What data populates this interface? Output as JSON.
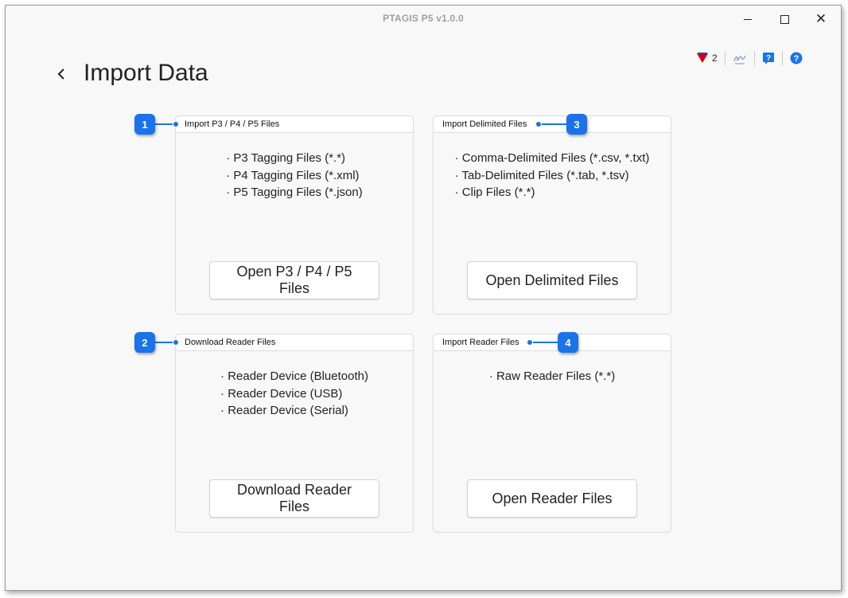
{
  "window": {
    "title": "PTAGIS P5 v1.0.0"
  },
  "toolbar": {
    "filter_count": "2",
    "icons": [
      "filter-flag-icon",
      "sign-icon",
      "help-book-icon",
      "help-circle-icon"
    ],
    "accent_color": "#1a73e8",
    "flag_color": "#d0021b"
  },
  "page": {
    "title": "Import Data"
  },
  "cards": [
    {
      "label": "Import P3 / P4 / P5 Files",
      "items": [
        "· P3 Tagging Files (*.*)",
        "· P4 Tagging Files (*.xml)",
        "· P5 Tagging Files (*.json)"
      ],
      "button": "Open P3 / P4 / P5 Files",
      "callout": "1"
    },
    {
      "label": "Import Delimited Files",
      "items": [
        "· Comma-Delimited Files (*.csv, *.txt)",
        "· Tab-Delimited Files (*.tab, *.tsv)",
        "· Clip Files (*.*)"
      ],
      "button": "Open Delimited Files",
      "callout": "3"
    },
    {
      "label": "Download Reader Files",
      "items": [
        "· Reader Device (Bluetooth)",
        "· Reader Device (USB)",
        "· Reader Device (Serial)"
      ],
      "button": "Download Reader Files",
      "callout": "2"
    },
    {
      "label": "Import Reader Files",
      "items": [
        "· Raw Reader Files (*.*)"
      ],
      "button": "Open Reader Files",
      "callout": "4"
    }
  ]
}
